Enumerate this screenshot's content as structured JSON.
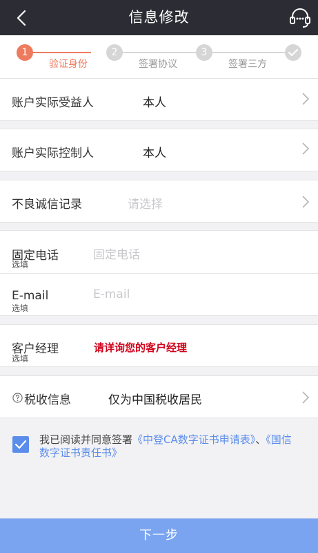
{
  "header": {
    "title": "信息修改",
    "back_icon": "chevron-left-icon",
    "service_icon": "headset-icon"
  },
  "steps": [
    {
      "number": "1",
      "label": "验证身份",
      "state": "active"
    },
    {
      "number": "2",
      "label": "签署协议",
      "state": "pending"
    },
    {
      "number": "3",
      "label": "签署三方",
      "state": "pending"
    },
    {
      "number": "",
      "label": "",
      "state": "done-icon"
    }
  ],
  "fields": {
    "beneficiary": {
      "label": "账户实际受益人",
      "value": "本人"
    },
    "controller": {
      "label": "账户实际控制人",
      "value": "本人"
    },
    "credit": {
      "label": "不良诚信记录",
      "placeholder": "请选择"
    },
    "phone": {
      "label": "固定电话",
      "sub": "选填",
      "placeholder": "固定电话"
    },
    "email": {
      "label": "E-mail",
      "sub": "选填",
      "placeholder": "E-mail"
    },
    "manager": {
      "label": "客户经理",
      "sub": "选填",
      "value": "请详询您的客户经理"
    },
    "tax": {
      "label": "税收信息",
      "value": "仅为中国税收居民"
    }
  },
  "agreement": {
    "checked": true,
    "prefix": "我已阅读并同意签署",
    "link1": "《中登CA数字证书申请表》",
    "separator": "、",
    "link2": "《国信数字证书责任书》"
  },
  "next_button": {
    "label": "下一步"
  },
  "colors": {
    "accent": "#ee7b5e",
    "primary": "#5b8dea",
    "button": "#7aa4f0",
    "header": "#2c2c34",
    "warning": "#d0021b"
  }
}
